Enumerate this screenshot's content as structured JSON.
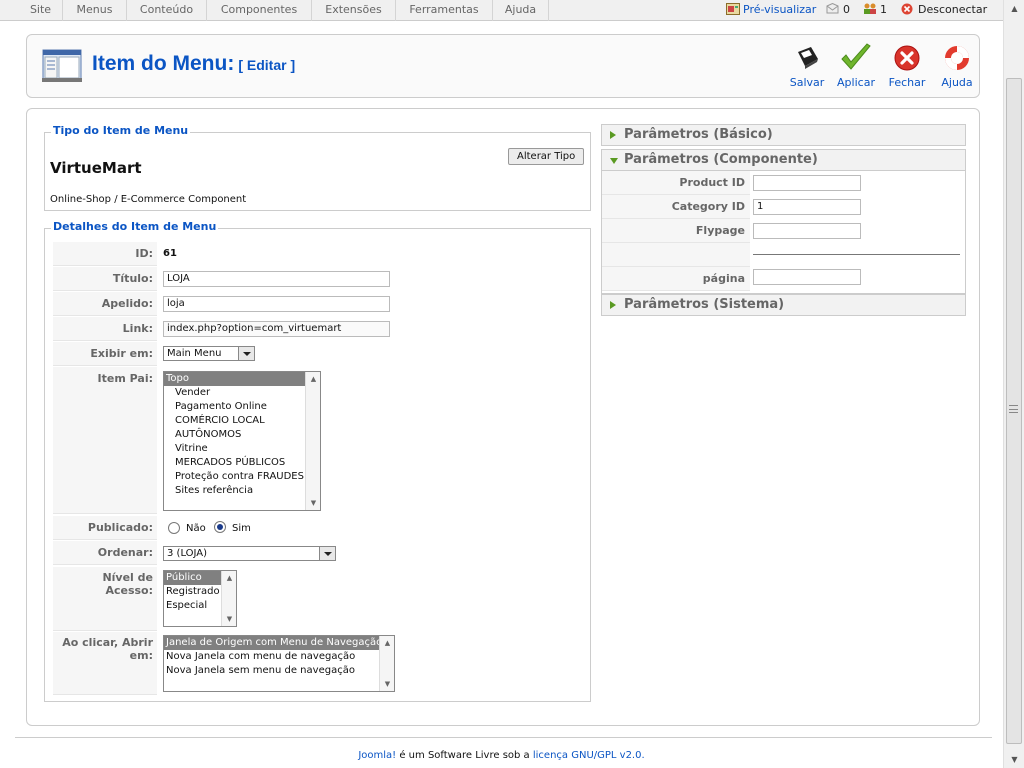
{
  "menubar": {
    "items": [
      "Site",
      "Menus",
      "Conteúdo",
      "Componentes",
      "Extensões",
      "Ferramentas",
      "Ajuda"
    ],
    "preview": "Pré-visualizar",
    "messages_count": "0",
    "users_count": "1",
    "logout": "Desconectar"
  },
  "header": {
    "title": "Item do Menu:",
    "subtitle": "[ Editar ]"
  },
  "toolbar": {
    "save": "Salvar",
    "apply": "Aplicar",
    "close": "Fechar",
    "help": "Ajuda"
  },
  "menu_type": {
    "legend": "Tipo do Item de Menu",
    "name": "VirtueMart",
    "description": "Online-Shop / E-Commerce Component",
    "change_button": "Alterar Tipo"
  },
  "details": {
    "legend": "Detalhes do Item de Menu",
    "id_label": "ID:",
    "id_value": "61",
    "title_label": "Título:",
    "title_value": "LOJA",
    "alias_label": "Apelido:",
    "alias_value": "loja",
    "link_label": "Link:",
    "link_value": "index.php?option=com_virtuemart",
    "menu_label": "Exibir em:",
    "menu_value": "Main Menu",
    "parent_label": "Item Pai:",
    "parent_options": [
      "Topo",
      "Vender",
      "Pagamento Online",
      "COMÉRCIO LOCAL",
      "AUTÔNOMOS",
      "Vitrine",
      "MERCADOS PÚBLICOS",
      "Proteção contra FRAUDES",
      "Sites referência"
    ],
    "published_label": "Publicado:",
    "published_no": "Não",
    "published_yes": "Sim",
    "order_label": "Ordenar:",
    "order_value": "3 (LOJA)",
    "access_label": "Nível de Acesso:",
    "access_options": [
      "Público",
      "Registrado",
      "Especial"
    ],
    "onclick_label_1": "Ao clicar, Abrir",
    "onclick_label_2": "em:",
    "onclick_options": [
      "Janela de Origem com Menu de Navegação",
      "Nova Janela com menu de navegação",
      "Nova Janela sem menu de navegação"
    ]
  },
  "params": {
    "basic": "Parâmetros (Básico)",
    "component": "Parâmetros (Componente)",
    "product_id_label": "Product ID",
    "product_id_value": "",
    "category_id_label": "Category ID",
    "category_id_value": "1",
    "flypage_label": "Flypage",
    "flypage_value": "",
    "pagina_label": "página",
    "pagina_value": "",
    "system": "Parâmetros (Sistema)"
  },
  "footer": {
    "joomla": "Joomla!",
    "text": " é um Software Livre sob a ",
    "license": "licença GNU/GPL v2.0."
  },
  "colors": {
    "accent_blue": "#0b55c4",
    "selection_gray": "#808080",
    "triangle_green": "#5a9a22"
  }
}
